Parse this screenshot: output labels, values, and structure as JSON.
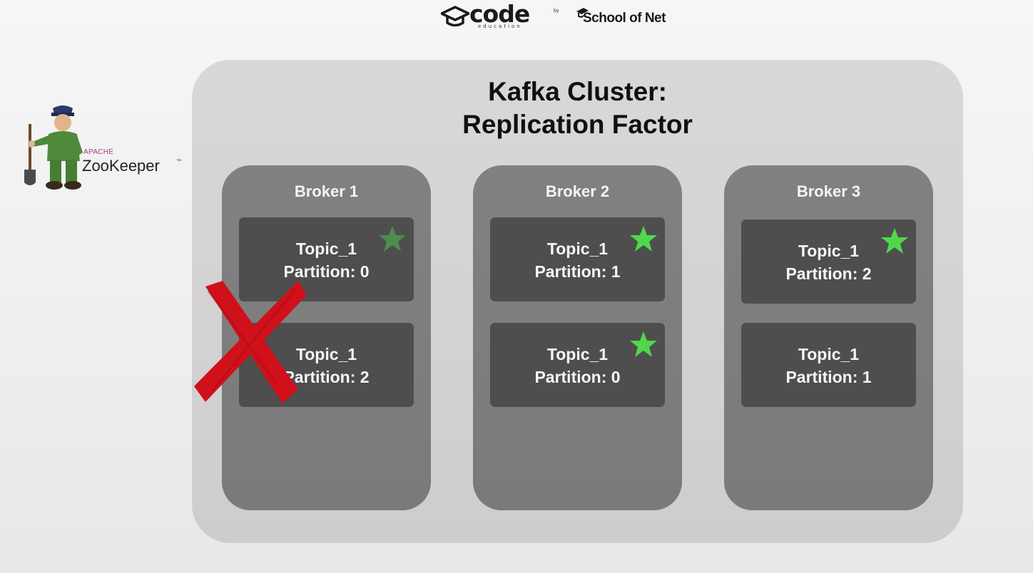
{
  "header": {
    "code_logo_text": "code",
    "code_logo_subtext": "education",
    "by_text": "by",
    "partner_logo_text": "School of Net"
  },
  "zookeeper": {
    "apache_label": "APACHE",
    "name": "ZooKeeper",
    "trademark": "™"
  },
  "cluster": {
    "title_line1": "Kafka Cluster:",
    "title_line2": "Replication Factor"
  },
  "brokers": [
    {
      "name": "Broker 1",
      "failed": true,
      "partitions": [
        {
          "topic": "Topic_1",
          "partition": "Partition: 0",
          "leader_star": "dim"
        },
        {
          "topic": "Topic_1",
          "partition": "Partition: 2",
          "leader_star": "none"
        }
      ]
    },
    {
      "name": "Broker 2",
      "failed": false,
      "partitions": [
        {
          "topic": "Topic_1",
          "partition": "Partition: 1",
          "leader_star": "bright"
        },
        {
          "topic": "Topic_1",
          "partition": "Partition: 0",
          "leader_star": "bright"
        }
      ]
    },
    {
      "name": "Broker 3",
      "failed": false,
      "partitions": [
        {
          "topic": "Topic_1",
          "partition": "Partition: 2",
          "leader_star": "bright"
        },
        {
          "topic": "Topic_1",
          "partition": "Partition: 1",
          "leader_star": "none"
        }
      ]
    }
  ],
  "colors": {
    "leader_star": "#4fd84a",
    "failure_mark": "#d0101a",
    "partition_box": "#4e4e4f",
    "broker_box": "#7d7d7d",
    "cluster_box": "#d5d3d4"
  },
  "icons": {
    "leader": "star-icon",
    "failure": "x-mark-icon",
    "mascot": "zookeeper-mascot-icon"
  }
}
